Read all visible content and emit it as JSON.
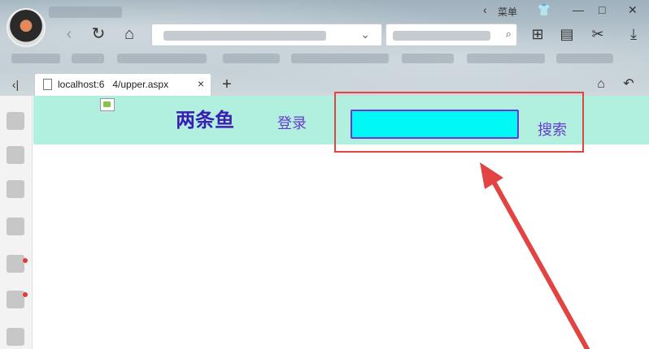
{
  "browser": {
    "menu_label": "菜单",
    "tab_title": "localhost:6   4/upper.aspx",
    "tab_close": "×",
    "new_tab": "+",
    "window_controls": {
      "minimize": "—",
      "maximize": "□",
      "close": "✕"
    }
  },
  "page": {
    "site_title": "两条鱼",
    "login_label": "登录",
    "search_value": "",
    "search_label": "搜索",
    "band_color": "#b1f0df",
    "input_color": "#00f9f5",
    "accent_color": "#6a3ad0"
  },
  "annotation": {
    "highlight_color": "#e24343"
  }
}
